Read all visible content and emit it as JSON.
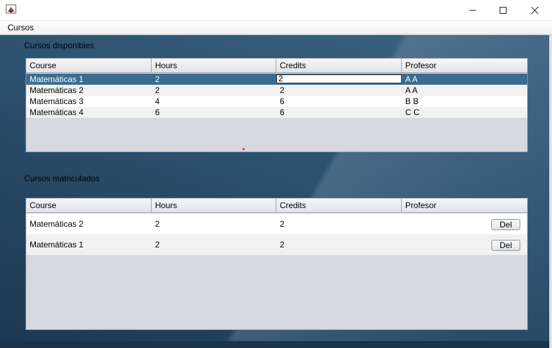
{
  "menu": {
    "items": [
      "Cursos"
    ]
  },
  "window": {
    "controls": [
      "minimize-icon",
      "maximize-icon",
      "close-icon"
    ]
  },
  "available": {
    "label": "Cursos disponibles",
    "headers": [
      "Course",
      "Hours",
      "Credits",
      "Profesor"
    ],
    "rows": [
      [
        "Matemáticas 1",
        "2",
        "2",
        "A A"
      ],
      [
        "Matemáticas 2",
        "2",
        "2",
        "A A"
      ],
      [
        "Matemáticas 3",
        "4",
        "6",
        "B B"
      ],
      [
        "Matemáticas 4",
        "6",
        "6",
        "C C"
      ]
    ],
    "editing_value": "2"
  },
  "enrolled": {
    "label": "Cursos matriculados",
    "headers": [
      "Course",
      "Hours",
      "Credits",
      "Profesor"
    ],
    "rows": [
      [
        "Matemáticas 2",
        "2",
        "2",
        ""
      ],
      [
        "Matemáticas 1",
        "2",
        "2",
        ""
      ]
    ],
    "del_label": "Del"
  },
  "colors": {
    "selection": "#3b6c8f",
    "background": "#2c4a63"
  }
}
